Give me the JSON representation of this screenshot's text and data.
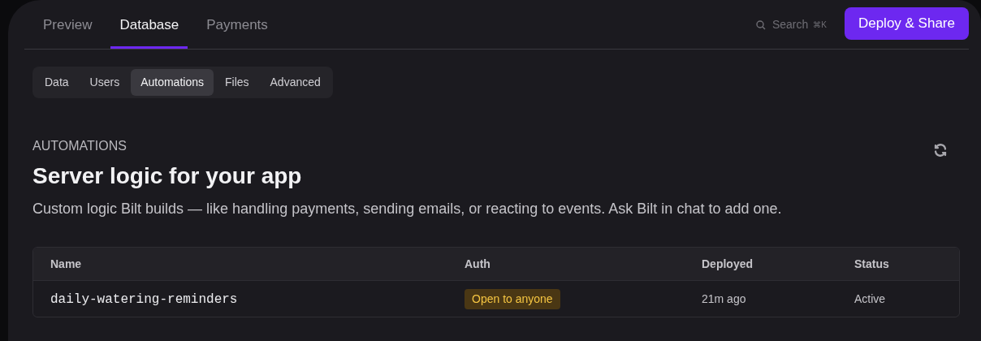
{
  "tabs": [
    {
      "label": "Preview",
      "selected": false
    },
    {
      "label": "Database",
      "selected": true
    },
    {
      "label": "Payments",
      "selected": false
    }
  ],
  "search": {
    "placeholder": "Search",
    "shortcut": "⌘K"
  },
  "deploy_button": "Deploy & Share",
  "subtabs": [
    {
      "label": "Data",
      "selected": false
    },
    {
      "label": "Users",
      "selected": false
    },
    {
      "label": "Automations",
      "selected": true
    },
    {
      "label": "Files",
      "selected": false
    },
    {
      "label": "Advanced",
      "selected": false
    }
  ],
  "section": {
    "eyebrow": "AUTOMATIONS",
    "title": "Server logic for your app",
    "description": "Custom logic Bilt builds — like handling payments, sending emails, or reacting to events. Ask Bilt in chat to add one."
  },
  "table": {
    "columns": [
      "Name",
      "Auth",
      "Deployed",
      "Status"
    ],
    "rows": [
      {
        "name": "daily-watering-reminders",
        "auth": "Open to anyone",
        "deployed": "21m ago",
        "status": "Active"
      }
    ]
  }
}
